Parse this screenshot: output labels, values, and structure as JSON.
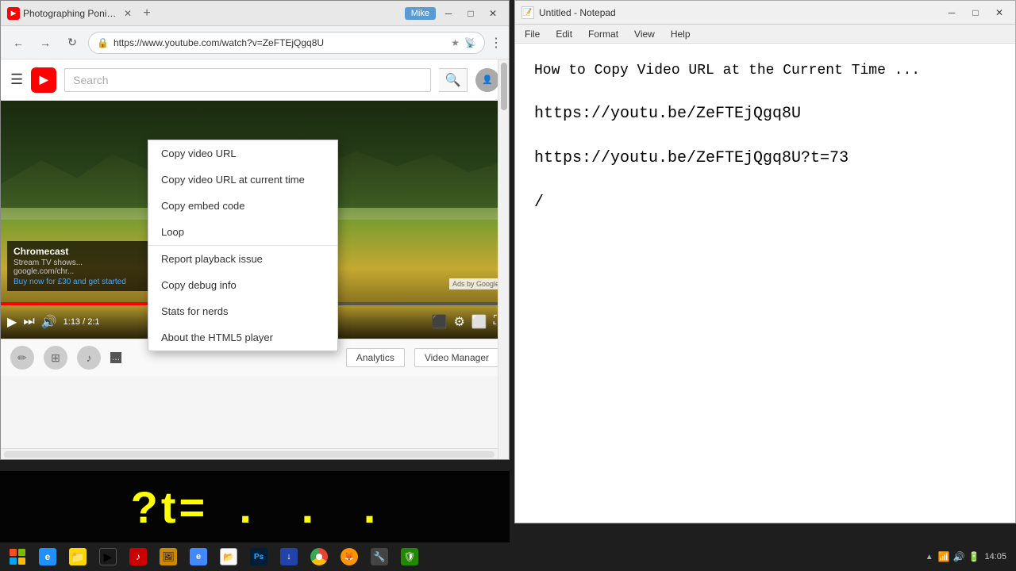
{
  "browser": {
    "tab_title": "Photographing Ponies fr",
    "url": "https://www.youtube.com/watch?v=ZeFTEjQgq8U",
    "user_label": "Mike",
    "search_placeholder": "Search",
    "nav_back": "←",
    "nav_forward": "→",
    "nav_refresh": "↻",
    "video_time": "1:13 / 2:1",
    "ad_title": "Chromecast",
    "ad_sub1": "Stream TV shows...",
    "ad_sub2": "google.com/chr...",
    "ad_cta": "Buy now for £30 and get started",
    "ads_by_google": "Ads by Google"
  },
  "context_menu": {
    "items": [
      "Copy video URL",
      "Copy video URL at current time",
      "Copy embed code",
      "Loop",
      "Report playback issue",
      "Copy debug info",
      "Stats for nerds",
      "About the HTML5 player"
    ]
  },
  "notepad": {
    "title": "Untitled - Notepad",
    "menu": {
      "file": "File",
      "edit": "Edit",
      "format": "Format",
      "view": "View",
      "help": "Help"
    },
    "content": {
      "heading": "How to Copy Video URL at the Current Time ...",
      "url1": "https://youtu.be/ZeFTEjQgq8U",
      "url2": "https://youtu.be/ZeFTEjQgq8U?t=73",
      "slash": "/"
    }
  },
  "overlay": {
    "text": "?t= ."
  },
  "taskbar": {
    "time": "14:05",
    "items": [
      {
        "name": "start",
        "label": "Start"
      },
      {
        "name": "ie",
        "label": "e"
      },
      {
        "name": "folder",
        "label": "📁"
      },
      {
        "name": "media-player",
        "label": "▶"
      },
      {
        "name": "music",
        "label": "♪"
      },
      {
        "name": "browser-1",
        "label": "🌐"
      },
      {
        "name": "browser-2",
        "label": "🦊"
      },
      {
        "name": "chrome",
        "label": ""
      },
      {
        "name": "notepad-task",
        "label": "📝"
      }
    ]
  },
  "below_video": {
    "analytics_btn": "Analytics",
    "video_manager_btn": "Video Manager"
  }
}
